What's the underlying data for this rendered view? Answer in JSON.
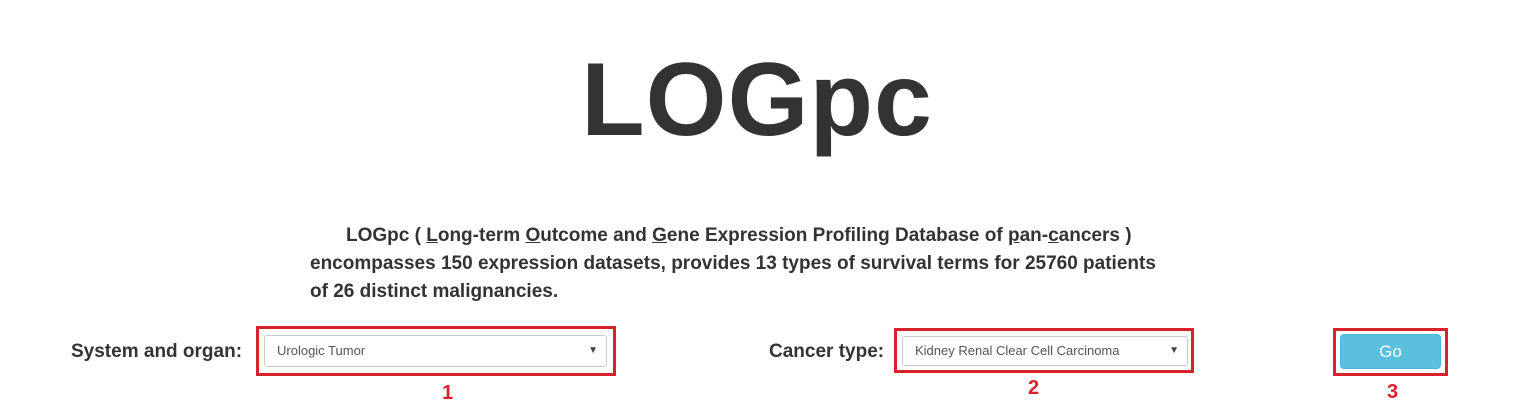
{
  "header": {
    "title": "LOGpc"
  },
  "description": {
    "prefix": "LOGpc ( ",
    "parts": [
      {
        "underlined": "L",
        "rest": "ong-term "
      },
      {
        "underlined": "O",
        "rest": "utcome and "
      },
      {
        "underlined": "G",
        "rest": "ene Expression Profiling Database of "
      },
      {
        "underlined": "p",
        "rest": "an-"
      },
      {
        "underlined": "c",
        "rest": "ancers )"
      }
    ],
    "line2": "encompasses 150 expression datasets, provides 13 types of survival terms for 25760 patients",
    "line3": "of 26 distinct malignancies."
  },
  "form": {
    "system_label": "System and organ:",
    "system_value": "Urologic Tumor",
    "cancer_label": "Cancer type:",
    "cancer_value": "Kidney Renal Clear Cell Carcinoma",
    "go_label": "Go",
    "arrow_glyph": "▼"
  },
  "annotations": {
    "step1": "1",
    "step2": "2",
    "step3": "3",
    "highlight_color": "#d9232c"
  },
  "colors": {
    "button": "#5bc0de",
    "text": "#333333"
  }
}
